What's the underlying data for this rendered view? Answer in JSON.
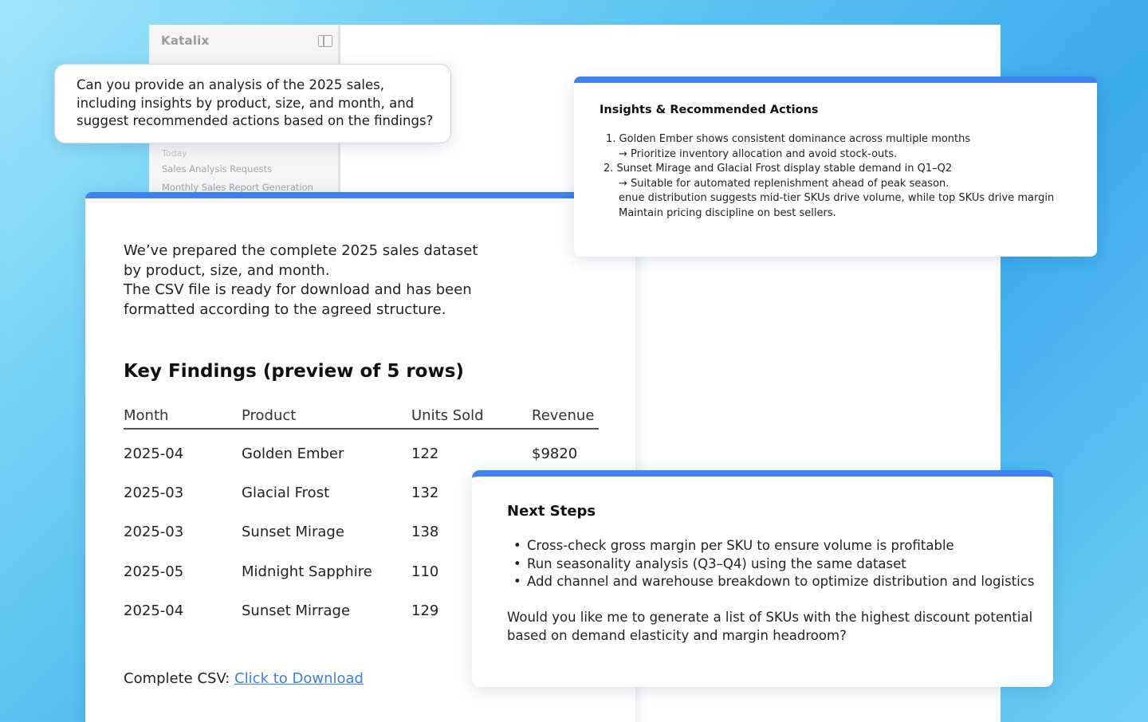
{
  "app": {
    "brand": "Katalix",
    "history_group": "Today",
    "history_items": [
      "Sales Analysis Requests",
      "Monthly Sales Report Generation"
    ]
  },
  "prompt": {
    "lines": [
      "Can you provide an analysis of the 2025 sales,",
      "including insights by product, size, and month, and",
      "suggest recommended actions based on the findings?"
    ]
  },
  "insights": {
    "title": "Insights & Recommended Actions",
    "lines": [
      "1. Golden Ember shows consistent dominance across multiple months",
      "→ Prioritize inventory allocation and avoid stock-outs.",
      "2. Sunset Mirage and Glacial Frost display stable demand in Q1–Q2",
      "→ Suitable for automated replenishment ahead of peak season.",
      "enue distribution suggests mid-tier SKUs drive volume, while top SKUs drive margin",
      "Maintain pricing discipline on best sellers."
    ]
  },
  "main": {
    "intro_lines": [
      "We’ve prepared the complete 2025 sales dataset",
      "by product, size, and month.",
      "The CSV file is ready for download and has been",
      "formatted according to the agreed structure."
    ],
    "findings_title": "Key Findings (preview of 5 rows)",
    "table": {
      "headers": [
        "Month",
        "Product",
        "Units Sold",
        "Revenue"
      ],
      "rows": [
        [
          "2025-04",
          "Golden Ember",
          "122",
          "$9820"
        ],
        [
          "2025-03",
          "Glacial Frost",
          "132",
          ""
        ],
        [
          "2025-03",
          "Sunset Mirage",
          "138",
          ""
        ],
        [
          "2025-05",
          "Midnight Sapphire",
          "110",
          ""
        ],
        [
          "2025-04",
          "Sunset Mirrage",
          "129",
          ""
        ]
      ]
    },
    "download_label": "Complete CSV: ",
    "download_link": "Click to Download"
  },
  "next_steps": {
    "title": "Next Steps",
    "items": [
      "Cross-check gross margin per SKU to ensure volume is profitable",
      "Run seasonality analysis (Q3–Q4) using the same dataset",
      "Add channel and warehouse breakdown to optimize distribution and logistics"
    ],
    "question_lines": [
      "Would you like me to generate a list of SKUs with the highest discount potential",
      "based on demand elasticity and margin headroom?"
    ]
  },
  "colors": {
    "accent": "#3d82ee",
    "link": "#3a7fe2"
  }
}
